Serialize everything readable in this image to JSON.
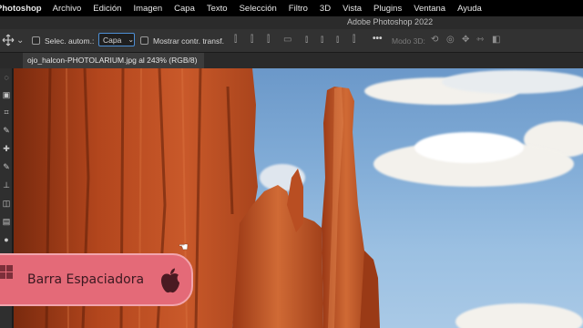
{
  "menubar": {
    "app": "Photoshop",
    "items": [
      "Archivo",
      "Edición",
      "Imagen",
      "Capa",
      "Texto",
      "Selección",
      "Filtro",
      "3D",
      "Vista",
      "Plugins",
      "Ventana",
      "Ayuda"
    ]
  },
  "window": {
    "title": "Adobe Photoshop 2022"
  },
  "options": {
    "auto_select_label": "Selec. autom.:",
    "auto_select_target": "Capa",
    "show_transform_label": "Mostrar contr. transf.",
    "mode3d_label": "Modo 3D:"
  },
  "document": {
    "tab_label": "ojo_halcon-PHOTOLARIUM.jpg al 243% (RGB/8)"
  },
  "overlay": {
    "key_label": "Barra Espaciadora"
  },
  "colors": {
    "accent": "#4d8fd6",
    "overlay": "#e46a78",
    "rock": "#b3461d"
  },
  "icons": [
    "move-tool-icon",
    "align-left-icon",
    "align-center-icon",
    "align-right-icon",
    "distribute-icon",
    "more-icon",
    "orbit-3d-icon",
    "roll-3d-icon",
    "pan-3d-icon",
    "slide-3d-icon",
    "scale-3d-icon",
    "apple-icon",
    "windows-icon",
    "hand-cursor-icon"
  ]
}
